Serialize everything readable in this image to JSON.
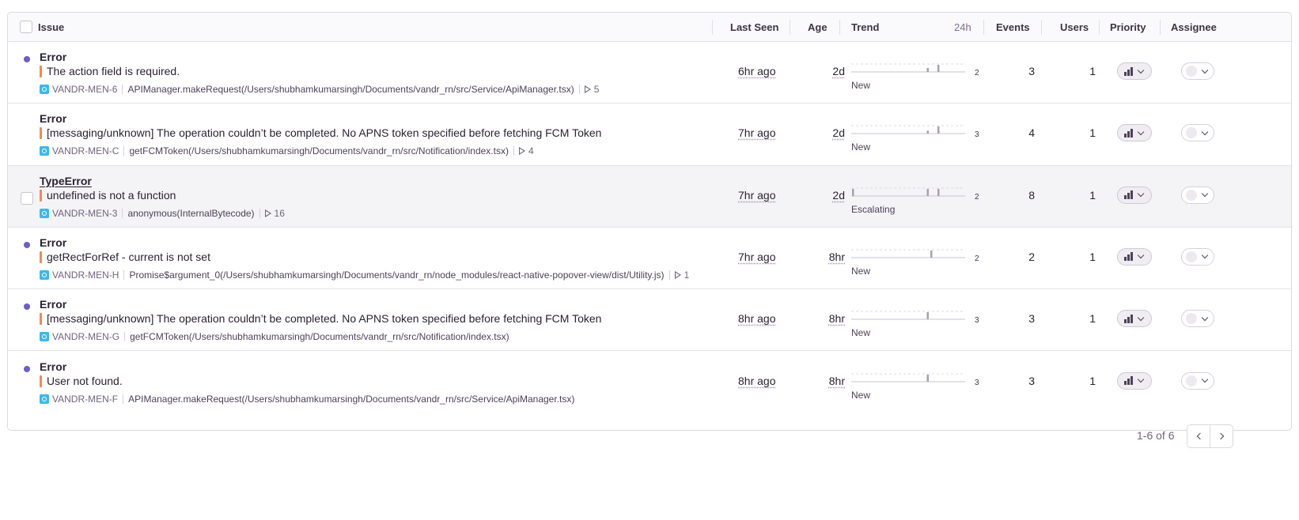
{
  "header": {
    "issue": "Issue",
    "last_seen": "Last Seen",
    "age": "Age",
    "trend": "Trend",
    "trend_period": "24h",
    "events": "Events",
    "users": "Users",
    "priority": "Priority",
    "assignee": "Assignee"
  },
  "rows": [
    {
      "unread": true,
      "title": "Error",
      "message": "The action field is required.",
      "short_id": "VANDR-MEN-6",
      "culprit": "APIManager.makeRequest(/Users/shubhamkumarsingh/Documents/vandr_rn/src/Service/ApiManager.tsx)",
      "replays": "5",
      "last_seen": "6hr ago",
      "age": "2d",
      "trend_max": "2",
      "trend_values": [
        0,
        0,
        0,
        0,
        0,
        0,
        0,
        0,
        0,
        0,
        0,
        0,
        0,
        0,
        0,
        0,
        0,
        0,
        0,
        0,
        0,
        1,
        0,
        0,
        2,
        0,
        0,
        0,
        0,
        0,
        0,
        0
      ],
      "trend_label": "New",
      "events": "3",
      "users": "1"
    },
    {
      "unread": false,
      "title": "Error",
      "message": "[messaging/unknown] The operation couldn’t be completed. No APNS token specified before fetching FCM Token",
      "short_id": "VANDR-MEN-C",
      "culprit": "getFCMToken(/Users/shubhamkumarsingh/Documents/vandr_rn/src/Notification/index.tsx)",
      "replays": "4",
      "last_seen": "7hr ago",
      "age": "2d",
      "trend_max": "3",
      "trend_values": [
        0,
        0,
        0,
        0,
        0,
        0,
        0,
        0,
        0,
        0,
        0,
        0,
        0,
        0,
        0,
        0,
        0,
        0,
        0,
        0,
        0,
        1,
        0,
        0,
        3,
        0,
        0,
        0,
        0,
        0,
        0,
        0
      ],
      "trend_label": "New",
      "events": "4",
      "users": "1"
    },
    {
      "unread": false,
      "hover": true,
      "title": "TypeError",
      "message": "undefined is not a function",
      "short_id": "VANDR-MEN-3",
      "culprit": "anonymous(InternalBytecode)",
      "replays": "16",
      "last_seen": "7hr ago",
      "age": "2d",
      "trend_max": "2",
      "trend_values": [
        1,
        0,
        0,
        0,
        0,
        0,
        0,
        0,
        0,
        0,
        0,
        0,
        0,
        0,
        0,
        0,
        0,
        0,
        0,
        0,
        0,
        1,
        0,
        0,
        1,
        0,
        0,
        0,
        0,
        0,
        0,
        0
      ],
      "trend_label": "Escalating",
      "events": "8",
      "users": "1"
    },
    {
      "unread": true,
      "title": "Error",
      "message": "getRectForRef - current is not set",
      "short_id": "VANDR-MEN-H",
      "culprit": "Promise$argument_0(/Users/shubhamkumarsingh/Documents/vandr_rn/node_modules/react-native-popover-view/dist/Utility.js)",
      "replays": "1",
      "last_seen": "7hr ago",
      "age": "8hr",
      "trend_max": "2",
      "trend_values": [
        0,
        0,
        0,
        0,
        0,
        0,
        0,
        0,
        0,
        0,
        0,
        0,
        0,
        0,
        0,
        0,
        0,
        0,
        0,
        0,
        0,
        0,
        2,
        0,
        0,
        0,
        0,
        0,
        0,
        0,
        0,
        0
      ],
      "trend_label": "New",
      "events": "2",
      "users": "1"
    },
    {
      "unread": true,
      "title": "Error",
      "message": "[messaging/unknown] The operation couldn’t be completed. No APNS token specified before fetching FCM Token",
      "short_id": "VANDR-MEN-G",
      "culprit": "getFCMToken(/Users/shubhamkumarsingh/Documents/vandr_rn/src/Notification/index.tsx)",
      "replays": "",
      "last_seen": "8hr ago",
      "age": "8hr",
      "trend_max": "3",
      "trend_values": [
        0,
        0,
        0,
        0,
        0,
        0,
        0,
        0,
        0,
        0,
        0,
        0,
        0,
        0,
        0,
        0,
        0,
        0,
        0,
        0,
        0,
        3,
        0,
        0,
        0,
        0,
        0,
        0,
        0,
        0,
        0,
        0
      ],
      "trend_label": "New",
      "events": "3",
      "users": "1"
    },
    {
      "unread": true,
      "title": "Error",
      "message": "User not found.",
      "short_id": "VANDR-MEN-F",
      "culprit": "APIManager.makeRequest(/Users/shubhamkumarsingh/Documents/vandr_rn/src/Service/ApiManager.tsx)",
      "replays": "",
      "last_seen": "8hr ago",
      "age": "8hr",
      "trend_max": "3",
      "trend_values": [
        0,
        0,
        0,
        0,
        0,
        0,
        0,
        0,
        0,
        0,
        0,
        0,
        0,
        0,
        0,
        0,
        0,
        0,
        0,
        0,
        0,
        3,
        0,
        0,
        0,
        0,
        0,
        0,
        0,
        0,
        0,
        0
      ],
      "trend_label": "New",
      "events": "3",
      "users": "1"
    }
  ],
  "pagination": {
    "summary": "1-6 of 6"
  },
  "colors": {
    "unread_dot": "#6c5fc7",
    "level_bar": "#f5894f",
    "platform_icon": "#3db8e8"
  },
  "icons": {
    "platform": "react-native-icon",
    "replay": "play-icon",
    "priority": "signal-bars-icon",
    "dropdown": "chevron-down-icon",
    "prev": "chevron-left-icon",
    "next": "chevron-right-icon"
  }
}
